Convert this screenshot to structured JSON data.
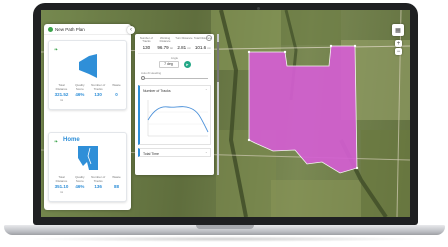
{
  "left_panel": {
    "title": "New Path Plan",
    "cards": [
      {
        "name": "",
        "stats": [
          {
            "label": "Total Distance",
            "value": "321.52",
            "unit": "mi"
          },
          {
            "label": "Quality Score",
            "value": "46%",
            "unit": ""
          },
          {
            "label": "Number of Tracks",
            "value": "130",
            "unit": ""
          },
          {
            "label": "Waste",
            "value": "0",
            "unit": ""
          }
        ]
      },
      {
        "name": "Home",
        "stats": [
          {
            "label": "Total Distance",
            "value": "351.10",
            "unit": "mi"
          },
          {
            "label": "Quality Score",
            "value": "46%",
            "unit": ""
          },
          {
            "label": "Number of Tracks",
            "value": "136",
            "unit": ""
          },
          {
            "label": "Waste",
            "value": "88",
            "unit": ""
          }
        ]
      }
    ]
  },
  "right_panel": {
    "metrics": [
      {
        "label": "Number of Tracks",
        "value": "130",
        "unit": ""
      },
      {
        "label": "Working Distance",
        "value": "96.79",
        "unit": "mi"
      },
      {
        "label": "Turn Distance",
        "value": "2.81",
        "unit": "mi"
      },
      {
        "label": "Total Distance",
        "value": "101.6",
        "unit": "mi"
      }
    ],
    "angle_label": "Angle",
    "angle_value": "7 deg",
    "auto_label": "Auto-fit Heading",
    "tracks_title": "Number of Tracks",
    "total_time_title": "Total Time"
  },
  "colors": {
    "field_fill": "#d45fd2",
    "accent": "#2f8fd8",
    "go_button": "#22a786"
  },
  "icons": {
    "collapse": "‹",
    "chevron_up": "ˆ",
    "chevron_down": "ˇ",
    "leaf": "❧",
    "go": "➤"
  }
}
